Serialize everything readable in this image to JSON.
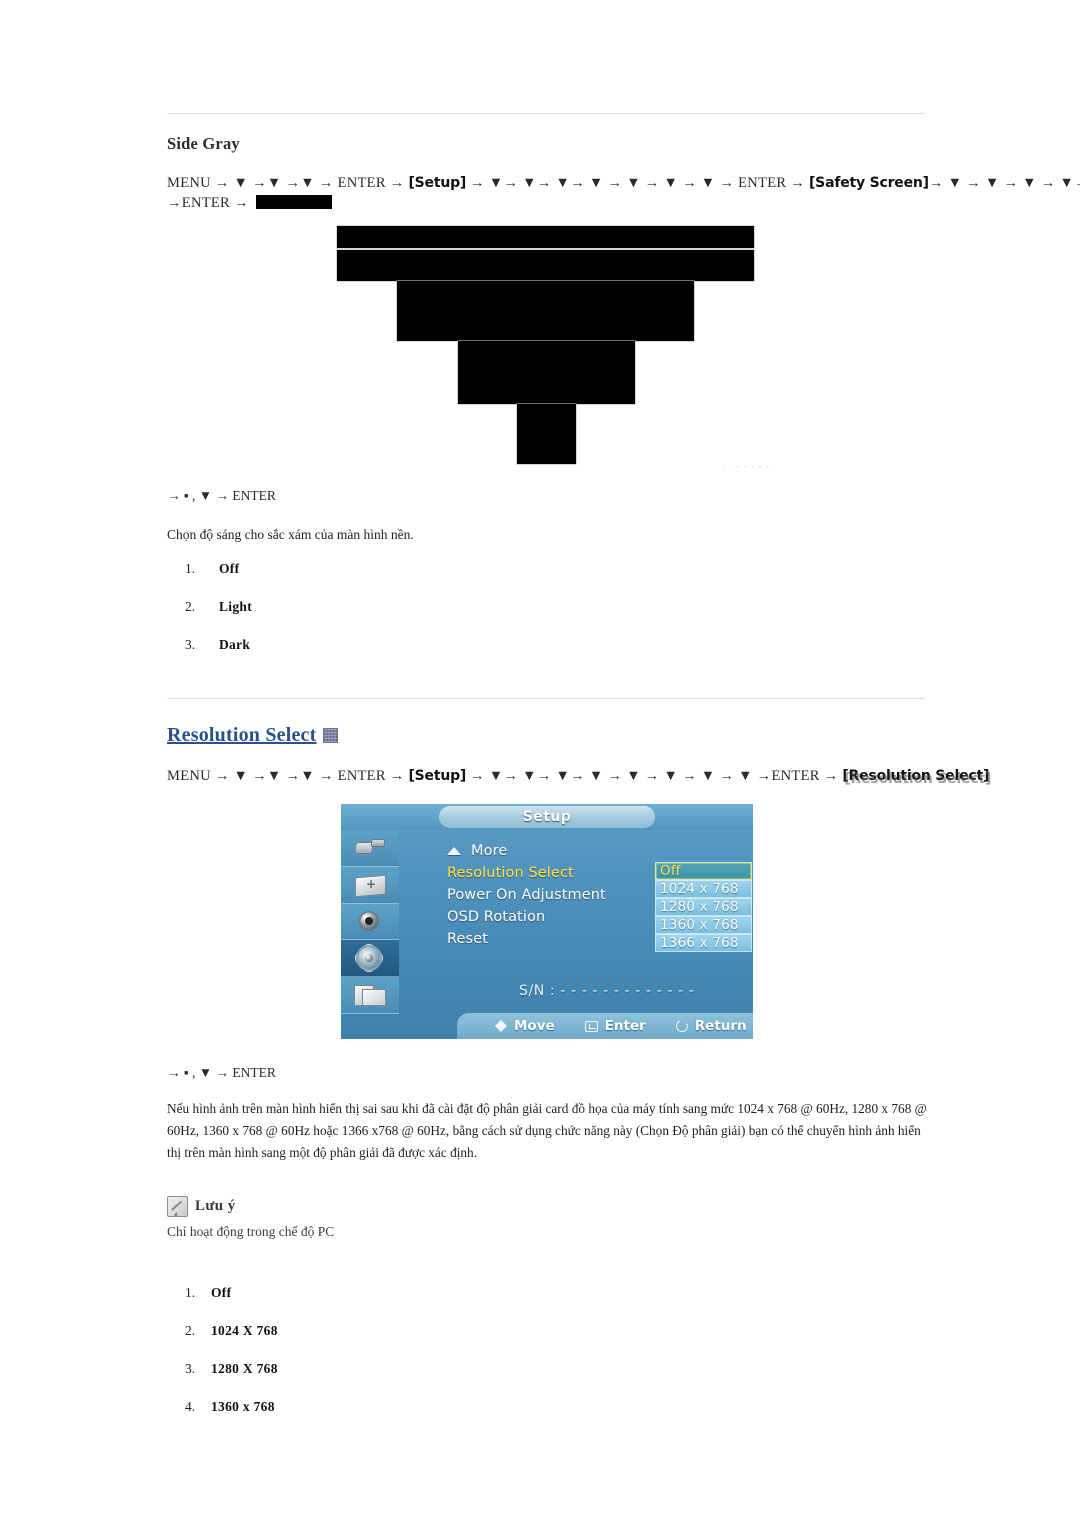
{
  "sections": [
    {
      "id": "side-gray",
      "heading": "Side Gray",
      "path_line1": "MENU → ▼ →▼ →▼ → ENTER → ",
      "path_setup": "[Setup]",
      "path_mid": " → ▼→ ▼→ ▼→ ▼ → ▼ → ▼ → ▼ → ENTER → ",
      "path_safety": "[Safety Screen]",
      "path_tail": "→ ▼ → ▼ → ▼ → ▼→ ▼",
      "path_line2_prefix": "→ENTER → ",
      "enter_line": "→ ▪ , ▼ → ENTER",
      "description": "Chọn độ sáng cho sắc xám của màn hình nền.",
      "options": [
        {
          "num": "1.",
          "label": "Off"
        },
        {
          "num": "2.",
          "label": "Light"
        },
        {
          "num": "3.",
          "label": "Dark"
        }
      ]
    },
    {
      "id": "resolution-select",
      "heading": "Resolution Select",
      "heading_icon": "thumbnail-icon",
      "path_prefix": "MENU → ▼ →▼ →▼ → ENTER → ",
      "path_setup": "[Setup]",
      "path_mid": " → ▼→ ▼→ ▼→ ▼ → ▼ → ▼ → ▼ → ▼ →ENTER → ",
      "path_token": "[Resolution Select]",
      "enter_line": "→ ▪ , ▼ → ENTER",
      "paragraph": "Nếu hình ảnh trên màn hình hiển thị sai sau khi đã cài đặt độ phân giải card đồ họa của máy tính sang mức 1024 x 768 @ 60Hz, 1280 x 768 @ 60Hz, 1360 x 768 @ 60Hz hoặc 1366 x768 @ 60Hz, bằng cách sử dụng chức năng này (Chọn Độ phân giải) bạn có thể chuyển hình ảnh hiển thị trên màn hình sang một độ phân giải đã được xác định.",
      "note": {
        "icon": "note-pencil-icon",
        "title": "Lưu ý",
        "text": "Chỉ hoạt động trong chế độ PC"
      },
      "options": [
        {
          "num": "1.",
          "label": "Off"
        },
        {
          "num": "2.",
          "label": "1024 X 768"
        },
        {
          "num": "3.",
          "label": "1280 X 768"
        },
        {
          "num": "4.",
          "label": "1360 x 768"
        }
      ]
    }
  ],
  "osd": {
    "title": "Setup",
    "sidebar_icons": [
      "input-source-icon",
      "picture-icon",
      "sound-icon",
      "setup-gear-icon",
      "multi-control-icon"
    ],
    "menu": {
      "more_label": "More",
      "rows": [
        {
          "name": "Resolution Select",
          "colon": ":",
          "active": true
        },
        {
          "name": "Power On Adjustment",
          "colon": "",
          "active": false
        },
        {
          "name": "OSD Rotation",
          "colon": ":",
          "active": false
        },
        {
          "name": "Reset",
          "colon": "",
          "active": false
        }
      ]
    },
    "dropdown": {
      "selected": "Off",
      "items": [
        "Off",
        "1024 x 768",
        "1280 x 768",
        "1360 x 768",
        "1366 x 768"
      ]
    },
    "serial": "S/N : - - - - - - - - - - - - -",
    "footer": [
      {
        "icon": "move-updown-icon",
        "label": "Move"
      },
      {
        "icon": "enter-key-icon",
        "label": "Enter"
      },
      {
        "icon": "return-arrow-icon",
        "label": "Return"
      }
    ]
  },
  "broken_image": {
    "faint_caption": "· ·  - - - - -",
    "alt": "missing-image-placeholder"
  },
  "colors": {
    "link": "#2b4f8e",
    "rule": "#dedede",
    "osd_blue": "#4f92bd",
    "osd_highlight": "#ffe14d"
  }
}
